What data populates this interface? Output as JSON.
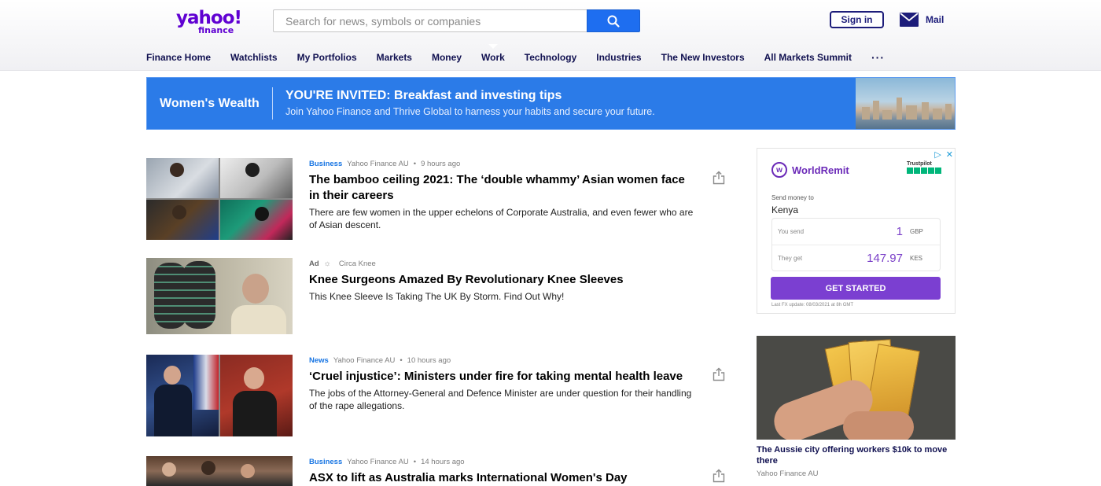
{
  "header": {
    "logo": {
      "brand": "yahoo!",
      "sub": "finance"
    },
    "search": {
      "placeholder": "Search for news, symbols or companies"
    },
    "signin_label": "Sign in",
    "mail_label": "Mail"
  },
  "nav": {
    "items": [
      "Finance Home",
      "Watchlists",
      "My Portfolios",
      "Markets",
      "Money",
      "Work",
      "Technology",
      "Industries",
      "The New Investors",
      "All Markets Summit"
    ],
    "active": "Work",
    "more": "···"
  },
  "banner": {
    "brand": "Women's Wealth",
    "title": "YOU'RE INVITED: Breakfast and investing tips",
    "subtitle": "Join Yahoo Finance and Thrive Global to harness your habits and secure your future."
  },
  "articles": [
    {
      "category": "Business",
      "source": "Yahoo Finance AU",
      "time": "9 hours ago",
      "headline": "The bamboo ceiling 2021: The ‘double whammy’ Asian women face in their careers",
      "summary": "There are few women in the upper echelons of Corporate Australia, and even fewer who are of Asian descent."
    },
    {
      "ad_label": "Ad",
      "source": "Circa Knee",
      "headline": "Knee Surgeons Amazed By Revolutionary Knee Sleeves",
      "summary": "This Knee Sleeve Is Taking The UK By Storm. Find Out Why!"
    },
    {
      "category": "News",
      "source": "Yahoo Finance AU",
      "time": "10 hours ago",
      "headline": "‘Cruel injustice’: Ministers under fire for taking mental health leave",
      "summary": "The jobs of the Attorney-General and Defence Minister are under question for their handling of the rape allegations."
    },
    {
      "category": "Business",
      "source": "Yahoo Finance AU",
      "time": "14 hours ago",
      "headline": "ASX to lift as Australia marks International Women's Day"
    }
  ],
  "sidebar_ad": {
    "brand": "WorldRemit",
    "brand_badge": "w",
    "trust_label": "Trustpilot",
    "send_label": "Send money to",
    "country": "Kenya",
    "you_send_label": "You send",
    "you_send_value": "1",
    "you_send_currency": "GBP",
    "they_get_label": "They get",
    "they_get_value": "147.97",
    "they_get_currency": "KES",
    "cta": "GET STARTED",
    "fx_update": "Last FX update: 08/03/2021 at 8h GMT"
  },
  "side_story": {
    "title": "The Aussie city offering workers $10k to move there",
    "source": "Yahoo Finance AU"
  },
  "colors": {
    "brand_purple": "#6001d2",
    "nav_text": "#101050",
    "search_blue": "#1e6ef0",
    "banner_blue": "#2b7be8",
    "category_blue": "#1875e3",
    "cta_purple": "#7b3fd1"
  }
}
